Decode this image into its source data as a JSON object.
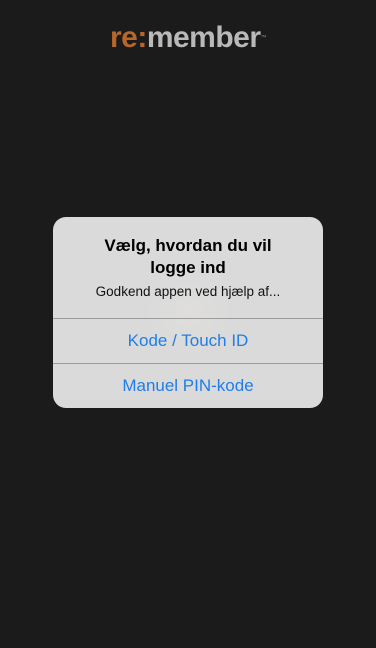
{
  "logo": {
    "accent": "re:",
    "main": "member",
    "tm": "™",
    "accent_color": "#b8672a",
    "main_color": "#b9b9b9"
  },
  "alert": {
    "title_line1": "Vælg, hvordan du vil",
    "title_line2": "logge ind",
    "message": "Godkend appen ved hjælp af...",
    "buttons": [
      {
        "label": "Kode / Touch ID"
      },
      {
        "label": "Manuel PIN-kode"
      }
    ],
    "button_color": "#1f7ee8"
  },
  "background_color": "#1b1b1b"
}
